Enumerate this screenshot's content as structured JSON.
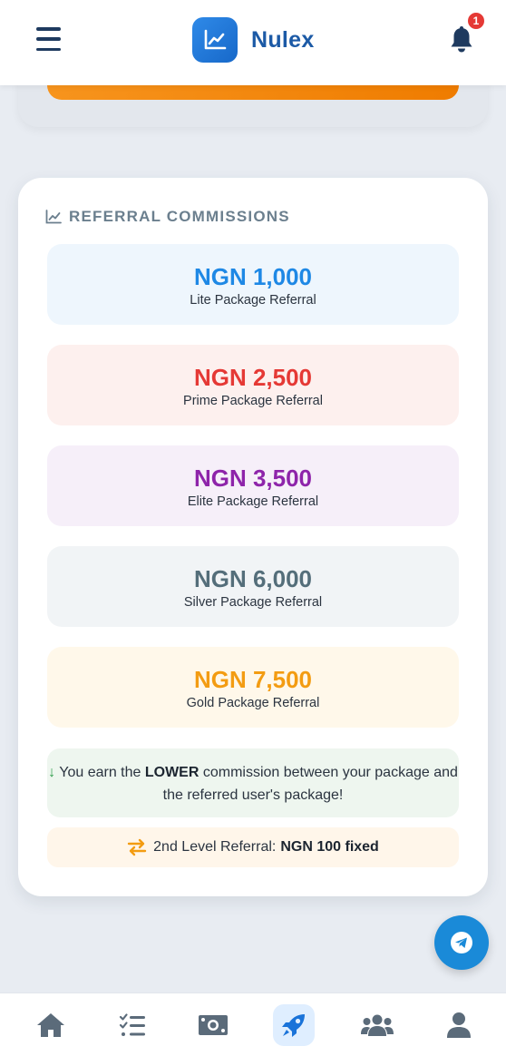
{
  "header": {
    "app_name": "Nulex",
    "notification_count": "1"
  },
  "referral": {
    "title": "REFERRAL COMMISSIONS",
    "packages": [
      {
        "amount": "NGN 1,000",
        "label": "Lite Package Referral",
        "color": "#1e88e5",
        "bg": "#eef6fd"
      },
      {
        "amount": "NGN 2,500",
        "label": "Prime Package Referral",
        "color": "#e53935",
        "bg": "#fdf0ee"
      },
      {
        "amount": "NGN 3,500",
        "label": "Elite Package Referral",
        "color": "#8e24aa",
        "bg": "#f6eff9"
      },
      {
        "amount": "NGN 6,000",
        "label": "Silver Package Referral",
        "color": "#546e7a",
        "bg": "#f1f4f6"
      },
      {
        "amount": "NGN 7,500",
        "label": "Gold Package Referral",
        "color": "#f39c12",
        "bg": "#fff8ea"
      }
    ],
    "note_prefix": "You earn the ",
    "note_bold": "LOWER",
    "note_suffix": " commission between your package and the referred user's package!",
    "level2_prefix": "2nd Level Referral:",
    "level2_bold": "NGN 100 fixed"
  },
  "colors": {
    "brand": "#1c5aa6",
    "accent_orange": "#f7941d",
    "telegram": "#1a8ad8"
  },
  "nav": {
    "items": [
      "home-icon",
      "tasks-icon",
      "money-icon",
      "rocket-icon",
      "users-icon",
      "profile-icon"
    ],
    "active": "rocket-icon"
  }
}
